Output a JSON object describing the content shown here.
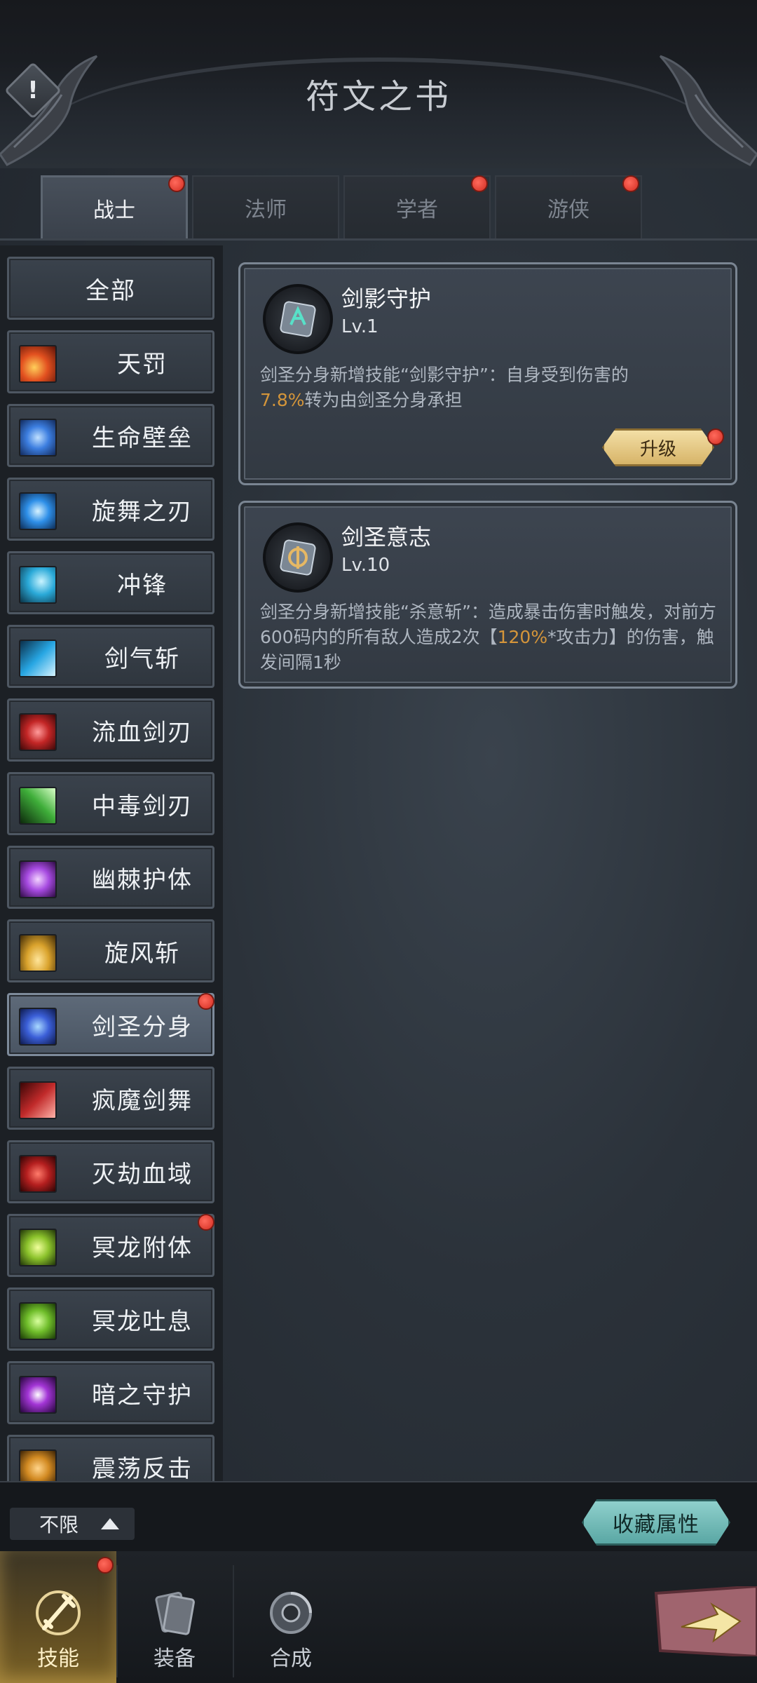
{
  "header": {
    "title": "符文之书",
    "alert_symbol": "!"
  },
  "class_tabs": [
    {
      "label": "战士",
      "active": true,
      "badge": true
    },
    {
      "label": "法师",
      "active": false,
      "badge": false
    },
    {
      "label": "学者",
      "active": false,
      "badge": true
    },
    {
      "label": "游侠",
      "active": false,
      "badge": true
    }
  ],
  "skills": [
    {
      "label": "全部",
      "icon": "none",
      "active": false,
      "badge": false
    },
    {
      "label": "天罚",
      "icon": "fire-burst-icon",
      "color": "#e2501f",
      "active": false,
      "badge": false
    },
    {
      "label": "生命壁垒",
      "icon": "shield-icon",
      "color": "#3c7ee0",
      "active": false,
      "badge": false
    },
    {
      "label": "旋舞之刃",
      "icon": "whirl-icon",
      "color": "#2e8fe8",
      "active": false,
      "badge": false
    },
    {
      "label": "冲锋",
      "icon": "dash-icon",
      "color": "#2aa9d8",
      "active": false,
      "badge": false
    },
    {
      "label": "剑气斩",
      "icon": "slash-icon",
      "color": "#27a6e3",
      "active": false,
      "badge": false
    },
    {
      "label": "流血剑刃",
      "icon": "bleed-blade-icon",
      "color": "#c32626",
      "active": false,
      "badge": false
    },
    {
      "label": "中毒剑刃",
      "icon": "poison-blade-icon",
      "color": "#3fae3a",
      "active": false,
      "badge": false
    },
    {
      "label": "幽棘护体",
      "icon": "thorn-armor-icon",
      "color": "#a64ae0",
      "active": false,
      "badge": false
    },
    {
      "label": "旋风斩",
      "icon": "cyclone-icon",
      "color": "#d9a22c",
      "active": false,
      "badge": false
    },
    {
      "label": "剑圣分身",
      "icon": "clone-icon",
      "color": "#3b5fd8",
      "active": true,
      "badge": true
    },
    {
      "label": "疯魔剑舞",
      "icon": "frenzy-icon",
      "color": "#c12a2a",
      "active": false,
      "badge": false
    },
    {
      "label": "灭劫血域",
      "icon": "blood-domain-icon",
      "color": "#b51f1f",
      "active": false,
      "badge": false
    },
    {
      "label": "冥龙附体",
      "icon": "dragon-possess-icon",
      "color": "#8bc22b",
      "active": false,
      "badge": true
    },
    {
      "label": "冥龙吐息",
      "icon": "dragon-breath-icon",
      "color": "#6fbd2a",
      "active": false,
      "badge": false
    },
    {
      "label": "暗之守护",
      "icon": "dark-guard-icon",
      "color": "#a335d6",
      "active": false,
      "badge": false
    },
    {
      "label": "震荡反击",
      "icon": "shock-counter-icon",
      "color": "#d28a22",
      "active": false,
      "badge": false
    }
  ],
  "runes": [
    {
      "name": "剑影守护",
      "level": "Lv.1",
      "icon": "rune-teal-icon",
      "desc_parts": [
        {
          "text": "剑圣分身新增技能“剑影守护”：自身受到伤害的",
          "hl": false
        },
        {
          "text": "7.8%",
          "hl": true
        },
        {
          "text": "转为由剑圣分身承担",
          "hl": false
        }
      ],
      "button": "升级"
    },
    {
      "name": "剑圣意志",
      "level": "Lv.10",
      "icon": "rune-gold-icon",
      "desc_parts": [
        {
          "text": "剑圣分身新增技能“杀意斩”：造成暴击伤害时触发，对前方600码内的所有敌人造成2次【",
          "hl": false
        },
        {
          "text": "120%",
          "hl": true
        },
        {
          "text": "*攻击力】的伤害，触发间隔1秒",
          "hl": false
        }
      ]
    }
  ],
  "filter": {
    "label": "不限"
  },
  "collect_button": "收藏属性",
  "bottom_nav": [
    {
      "label": "技能",
      "icon": "sword-icon",
      "active": true,
      "badge": true
    },
    {
      "label": "装备",
      "icon": "cards-icon",
      "active": false,
      "badge": false
    },
    {
      "label": "合成",
      "icon": "synthesis-icon",
      "active": false,
      "badge": false
    }
  ],
  "colors": {
    "highlight": "#d4953a",
    "accent_teal": "#6fbdb9",
    "badge_red": "#e0382b"
  }
}
